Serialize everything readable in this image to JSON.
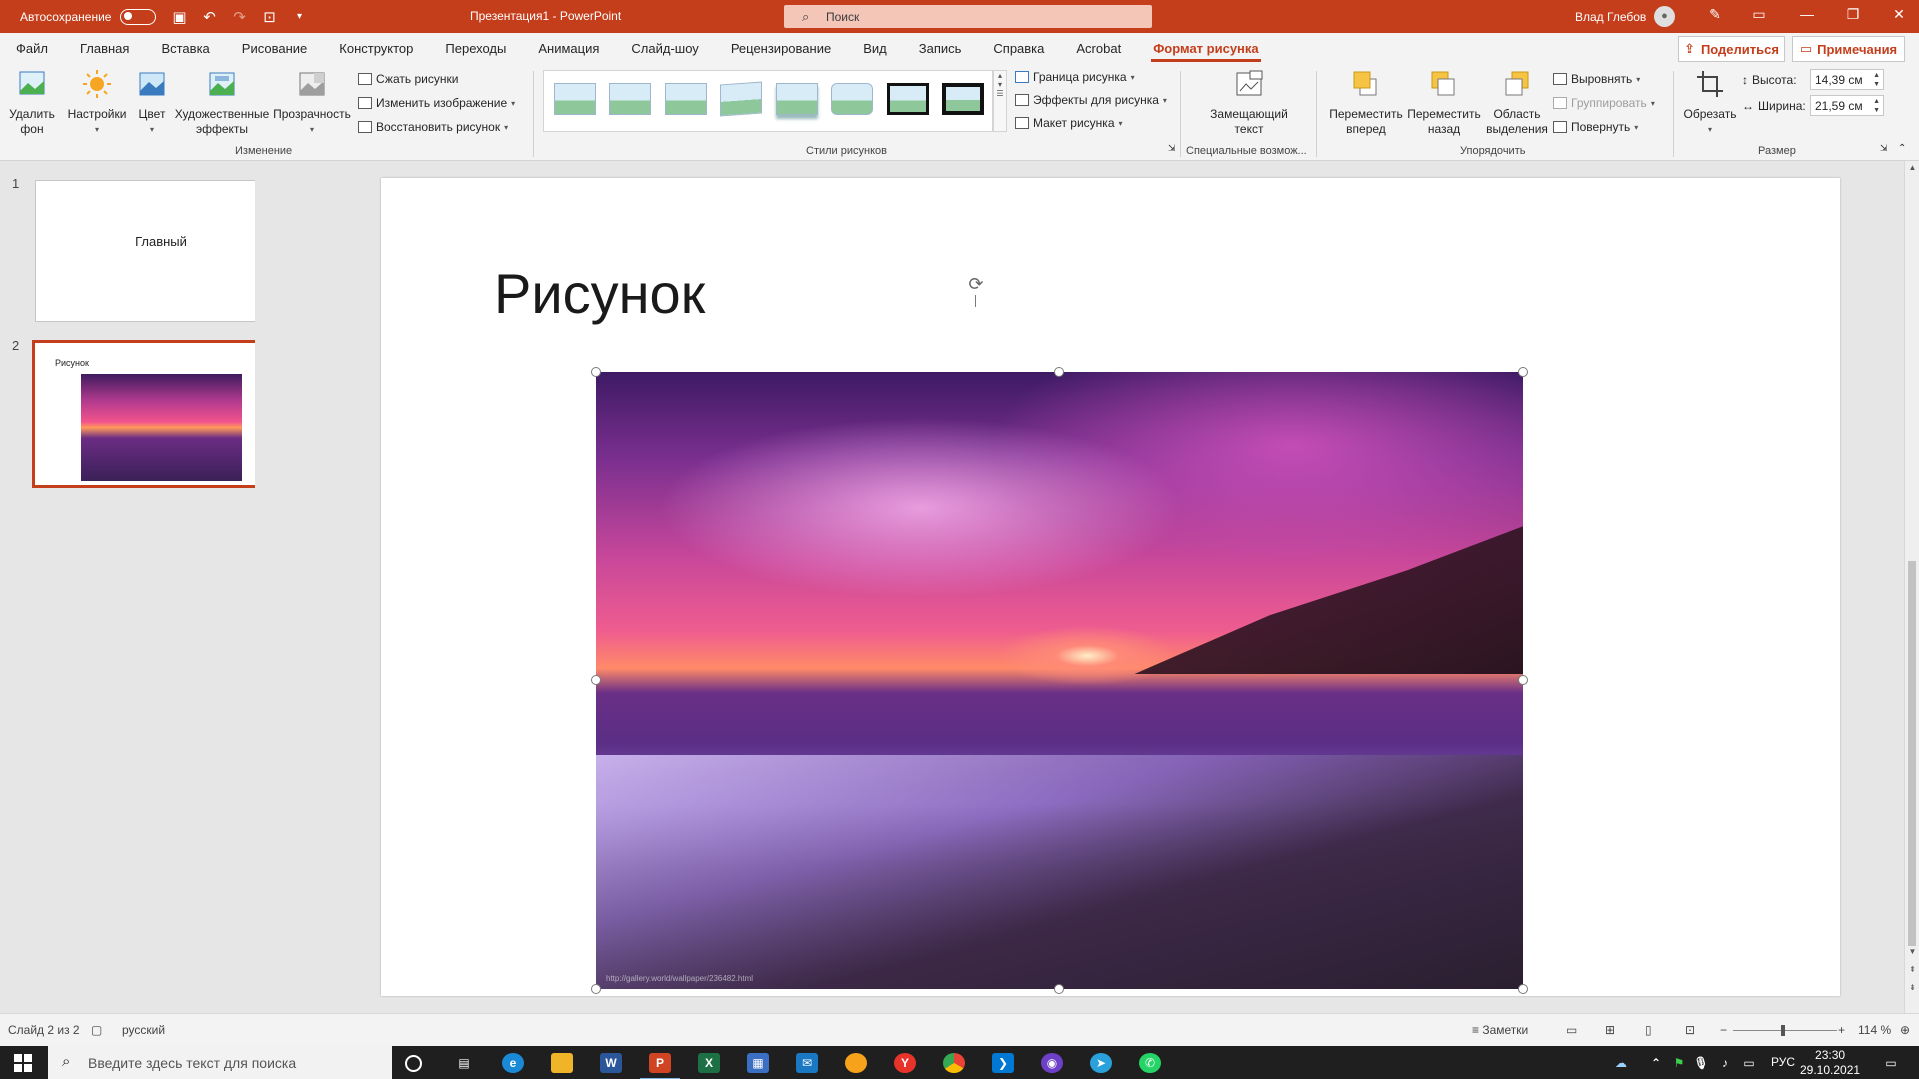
{
  "titlebar": {
    "autosave_label": "Автосохранение",
    "doc_title": "Презентация1  -  PowerPoint",
    "search_placeholder": "Поиск",
    "user_name": "Влад Глебов"
  },
  "tabs": [
    "Файл",
    "Главная",
    "Вставка",
    "Рисование",
    "Конструктор",
    "Переходы",
    "Анимация",
    "Слайд-шоу",
    "Рецензирование",
    "Вид",
    "Запись",
    "Справка",
    "Acrobat",
    "Формат рисунка"
  ],
  "active_tab": "Формат рисунка",
  "share_label": "Поделиться",
  "comments_label": "Примечания",
  "ribbon": {
    "remove_bg": [
      "Удалить",
      "фон"
    ],
    "corrections": "Настройки",
    "color": "Цвет",
    "artistic": [
      "Художественные",
      "эффекты"
    ],
    "transparency": "Прозрачность",
    "compress": "Сжать рисунки",
    "change_picture": "Изменить изображение",
    "reset_picture": "Восстановить рисунок",
    "group_adjust": "Изменение",
    "border": "Граница рисунка",
    "effects": "Эффекты для рисунка",
    "layout": "Макет рисунка",
    "group_styles": "Стили рисунков",
    "alt_text": [
      "Замещающий",
      "текст"
    ],
    "group_access": "Специальные возмож...",
    "bring_forward": [
      "Переместить",
      "вперед"
    ],
    "send_backward": [
      "Переместить",
      "назад"
    ],
    "selection_pane": [
      "Область",
      "выделения"
    ],
    "align": "Выровнять",
    "group_objects": "Группировать",
    "rotate": "Повернуть",
    "group_arrange": "Упорядочить",
    "crop": "Обрезать",
    "height_label": "Высота:",
    "height_value": "14,39 см",
    "width_label": "Ширина:",
    "width_value": "21,59 см",
    "group_size": "Размер"
  },
  "slides": [
    {
      "number": "1",
      "text": "Главный"
    },
    {
      "number": "2",
      "text": "Рисунок"
    }
  ],
  "slide": {
    "title": "Рисунок",
    "image_caption": "http://gallery.world/wallpaper/236482.html"
  },
  "statusbar": {
    "slide_info": "Слайд 2 из 2",
    "language": "русский",
    "notes": "Заметки",
    "zoom": "114 %"
  },
  "taskbar": {
    "search_placeholder": "Введите здесь текст для поиска",
    "lang": "РУС",
    "time": "23:30",
    "date": "29.10.2021"
  },
  "colors": {
    "accent": "#c43e1c",
    "ribbon_bg": "#f3f3f3",
    "taskbar_bg": "#1f1f1f"
  }
}
